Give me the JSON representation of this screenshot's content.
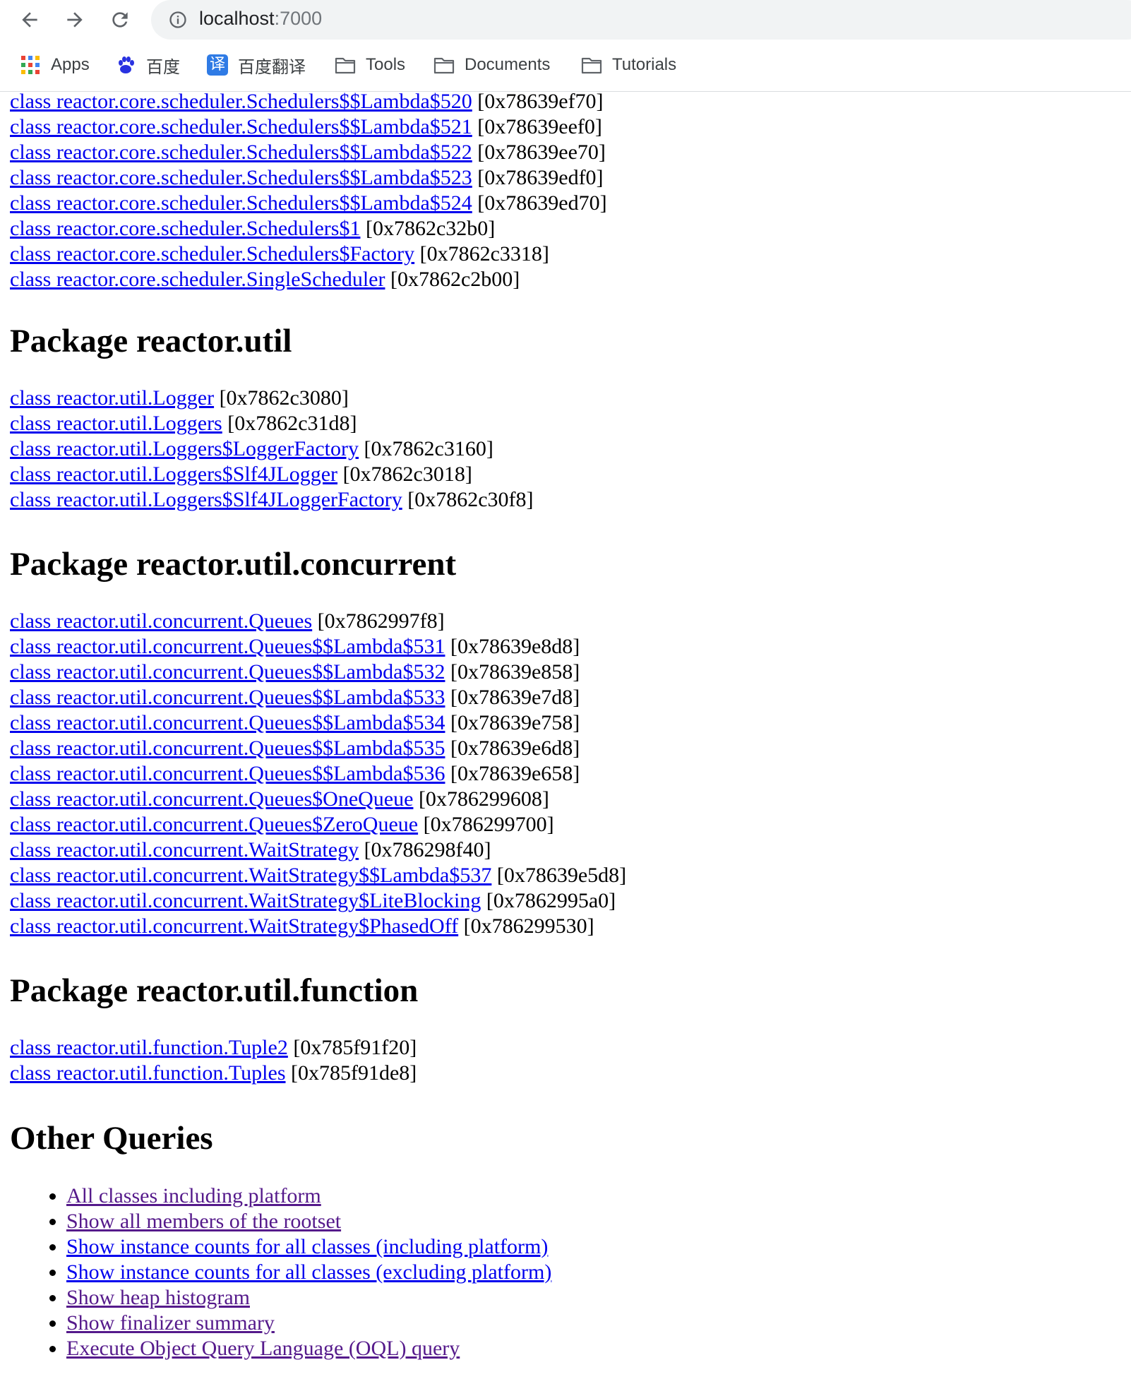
{
  "browser": {
    "url_host": "localhost",
    "url_port": ":7000",
    "bookmarks": [
      {
        "label": "Apps",
        "icon": "apps-grid-icon"
      },
      {
        "label": "百度",
        "icon": "baidu-paw-icon"
      },
      {
        "label": "百度翻译",
        "icon": "fanyi-icon"
      },
      {
        "label": "Tools",
        "icon": "folder-icon"
      },
      {
        "label": "Documents",
        "icon": "folder-icon"
      },
      {
        "label": "Tutorials",
        "icon": "folder-icon"
      }
    ],
    "fanyi_glyph": "译"
  },
  "scheduler_rows": [
    {
      "name": "class reactor.core.scheduler.Schedulers$$Lambda$520",
      "addr": "[0x78639ef70]"
    },
    {
      "name": "class reactor.core.scheduler.Schedulers$$Lambda$521",
      "addr": "[0x78639eef0]"
    },
    {
      "name": "class reactor.core.scheduler.Schedulers$$Lambda$522",
      "addr": "[0x78639ee70]"
    },
    {
      "name": "class reactor.core.scheduler.Schedulers$$Lambda$523",
      "addr": "[0x78639edf0]"
    },
    {
      "name": "class reactor.core.scheduler.Schedulers$$Lambda$524",
      "addr": "[0x78639ed70]"
    },
    {
      "name": "class reactor.core.scheduler.Schedulers$1",
      "addr": "[0x7862c32b0]"
    },
    {
      "name": "class reactor.core.scheduler.Schedulers$Factory",
      "addr": "[0x7862c3318]"
    },
    {
      "name": "class reactor.core.scheduler.SingleScheduler",
      "addr": "[0x7862c2b00]"
    }
  ],
  "packages": [
    {
      "heading": "Package reactor.util",
      "rows": [
        {
          "name": "class reactor.util.Logger",
          "addr": "[0x7862c3080]"
        },
        {
          "name": "class reactor.util.Loggers",
          "addr": "[0x7862c31d8]"
        },
        {
          "name": "class reactor.util.Loggers$LoggerFactory",
          "addr": "[0x7862c3160]"
        },
        {
          "name": "class reactor.util.Loggers$Slf4JLogger",
          "addr": "[0x7862c3018]"
        },
        {
          "name": "class reactor.util.Loggers$Slf4JLoggerFactory",
          "addr": "[0x7862c30f8]"
        }
      ]
    },
    {
      "heading": "Package reactor.util.concurrent",
      "rows": [
        {
          "name": "class reactor.util.concurrent.Queues",
          "addr": "[0x7862997f8]"
        },
        {
          "name": "class reactor.util.concurrent.Queues$$Lambda$531",
          "addr": "[0x78639e8d8]"
        },
        {
          "name": "class reactor.util.concurrent.Queues$$Lambda$532",
          "addr": "[0x78639e858]"
        },
        {
          "name": "class reactor.util.concurrent.Queues$$Lambda$533",
          "addr": "[0x78639e7d8]"
        },
        {
          "name": "class reactor.util.concurrent.Queues$$Lambda$534",
          "addr": "[0x78639e758]"
        },
        {
          "name": "class reactor.util.concurrent.Queues$$Lambda$535",
          "addr": "[0x78639e6d8]"
        },
        {
          "name": "class reactor.util.concurrent.Queues$$Lambda$536",
          "addr": "[0x78639e658]"
        },
        {
          "name": "class reactor.util.concurrent.Queues$OneQueue",
          "addr": "[0x786299608]"
        },
        {
          "name": "class reactor.util.concurrent.Queues$ZeroQueue",
          "addr": "[0x786299700]"
        },
        {
          "name": "class reactor.util.concurrent.WaitStrategy",
          "addr": "[0x786298f40]"
        },
        {
          "name": "class reactor.util.concurrent.WaitStrategy$$Lambda$537",
          "addr": "[0x78639e5d8]"
        },
        {
          "name": "class reactor.util.concurrent.WaitStrategy$LiteBlocking",
          "addr": "[0x7862995a0]"
        },
        {
          "name": "class reactor.util.concurrent.WaitStrategy$PhasedOff",
          "addr": "[0x786299530]"
        }
      ]
    },
    {
      "heading": "Package reactor.util.function",
      "rows": [
        {
          "name": "class reactor.util.function.Tuple2",
          "addr": "[0x785f91f20]"
        },
        {
          "name": "class reactor.util.function.Tuples",
          "addr": "[0x785f91de8]"
        }
      ]
    }
  ],
  "other": {
    "heading": "Other Queries",
    "items": [
      {
        "label": "All classes including platform",
        "visited": true
      },
      {
        "label": "Show all members of the rootset",
        "visited": true
      },
      {
        "label": "Show instance counts for all classes (including platform)",
        "visited": false
      },
      {
        "label": "Show instance counts for all classes (excluding platform)",
        "visited": false
      },
      {
        "label": "Show heap histogram",
        "visited": true
      },
      {
        "label": "Show finalizer summary",
        "visited": true
      },
      {
        "label": "Execute Object Query Language (OQL) query",
        "visited": true
      }
    ]
  },
  "colors": {
    "link": "#0000ee",
    "visited_link": "#551a8b"
  }
}
